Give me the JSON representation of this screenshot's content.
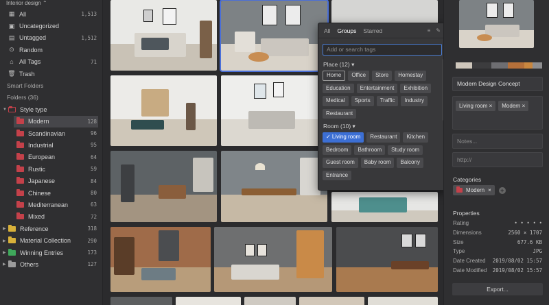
{
  "library": {
    "title": "Interior design",
    "caret": "⌃"
  },
  "sidebar": {
    "top_items": [
      {
        "label": "All",
        "count": "1,513",
        "icon": "all-icon"
      },
      {
        "label": "Uncategorized",
        "count": "",
        "icon": "uncategorized-icon"
      },
      {
        "label": "Untagged",
        "count": "1,512",
        "icon": "untagged-icon"
      },
      {
        "label": "Random",
        "count": "",
        "icon": "random-icon"
      },
      {
        "label": "All Tags",
        "count": "71",
        "icon": "tag-icon"
      },
      {
        "label": "Trash",
        "count": "",
        "icon": "trash-icon"
      }
    ],
    "smart_folders_label": "Smart Folders",
    "folders_label": "Folders (36)",
    "style_type": {
      "label": "Style type",
      "children": [
        {
          "label": "Modern",
          "count": "128",
          "selected": true
        },
        {
          "label": "Scandinavian",
          "count": "96"
        },
        {
          "label": "Industrial",
          "count": "95"
        },
        {
          "label": "European",
          "count": "64"
        },
        {
          "label": "Rustic",
          "count": "59"
        },
        {
          "label": "Japanese",
          "count": "84"
        },
        {
          "label": "Chinese",
          "count": "80"
        },
        {
          "label": "Mediterranean",
          "count": "63"
        },
        {
          "label": "Mixed",
          "count": "72"
        }
      ]
    },
    "other_folders": [
      {
        "label": "Reference",
        "count": "318",
        "color": "yellow"
      },
      {
        "label": "Material Collection",
        "count": "290",
        "color": "yellow"
      },
      {
        "label": "Winning Entries",
        "count": "173",
        "color": "green"
      },
      {
        "label": "Others",
        "count": "127",
        "color": "grey"
      }
    ]
  },
  "tag_popup": {
    "tabs": [
      "All",
      "Groups",
      "Starred"
    ],
    "active_tab": "Groups",
    "search_placeholder": "Add or search tags",
    "place_group": {
      "label": "Place (12) ▾",
      "tags": [
        "Home",
        "Office",
        "Store",
        "Homestay",
        "Education",
        "Entertainment",
        "Exhibition",
        "Medical",
        "Sports",
        "Traffic",
        "Industry",
        "Restaurant"
      ]
    },
    "room_group": {
      "label": "Room (10) ▾",
      "tags": [
        "✓ Living room",
        "Restaurant",
        "Kitchen",
        "Bedroom",
        "Bathroom",
        "Study room",
        "Guest room",
        "Baby room",
        "Balcony",
        "Entrance"
      ]
    }
  },
  "inspector": {
    "palette": [
      "#cfc7bc",
      "#3c3c3e",
      "#6e6e72",
      "#b5703a",
      "#c9873f",
      "#8e8e90"
    ],
    "name": "Modern Design Concept",
    "tags": [
      "Living room ×",
      "Modern ×"
    ],
    "notes_placeholder": "Notes...",
    "url_placeholder": "http://",
    "categories_label": "Categories",
    "category": "Modern",
    "category_remove": "×",
    "add_symbol": "+",
    "properties_label": "Properties",
    "properties": [
      {
        "key": "Rating",
        "value": "• • • • •"
      },
      {
        "key": "Dimensions",
        "value": "2560 × 1707"
      },
      {
        "key": "Size",
        "value": "677.6 KB"
      },
      {
        "key": "Type",
        "value": "JPG"
      },
      {
        "key": "Date Created",
        "value": "2019/08/02 15:57"
      },
      {
        "key": "Date Modified",
        "value": "2019/08/02 15:57"
      }
    ],
    "export_label": "Export..."
  }
}
